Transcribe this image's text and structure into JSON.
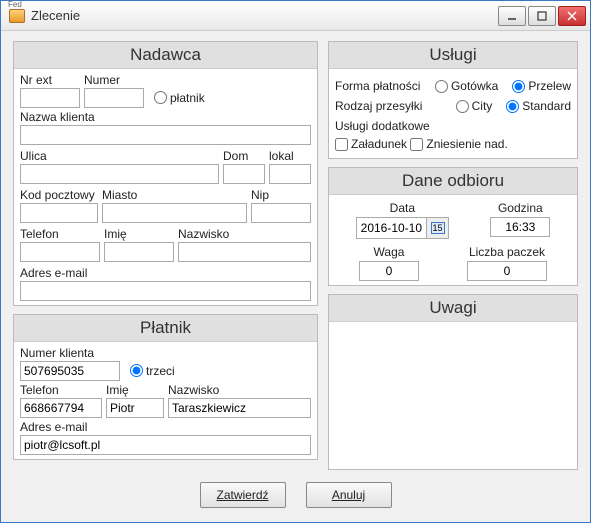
{
  "window": {
    "title": "Zlecenie"
  },
  "nadawca": {
    "heading": "Nadawca",
    "nr_ext_label": "Nr ext",
    "numer_label": "Numer",
    "platnik_radio": "płatnik",
    "nazwa_klienta_label": "Nazwa klienta",
    "ulica_label": "Ulica",
    "dom_label": "Dom",
    "lokal_label": "lokal",
    "kod_label": "Kod pocztowy",
    "miasto_label": "Miasto",
    "nip_label": "Nip",
    "telefon_label": "Telefon",
    "imie_label": "Imię",
    "nazwisko_label": "Nazwisko",
    "email_label": "Adres e-mail",
    "nr_ext": "",
    "numer": "",
    "nazwa_klienta": "",
    "ulica": "",
    "dom": "",
    "lokal": "",
    "kod": "",
    "miasto": "",
    "nip": "",
    "telefon": "",
    "imie": "",
    "nazwisko": "",
    "email": ""
  },
  "platnik": {
    "heading": "Płatnik",
    "numer_klienta_label": "Numer klienta",
    "trzeci_radio": "trzeci",
    "telefon_label": "Telefon",
    "imie_label": "Imię",
    "nazwisko_label": "Nazwisko",
    "email_label": "Adres e-mail",
    "numer_klienta": "507695035",
    "telefon": "668667794",
    "imie": "Piotr",
    "nazwisko": "Taraszkiewicz",
    "email": "piotr@lcsoft.pl"
  },
  "uslugi": {
    "heading": "Usługi",
    "forma_label": "Forma płatności",
    "gotowka": "Gotówka",
    "przelew": "Przelew",
    "rodzaj_label": "Rodzaj przesyłki",
    "city": "City",
    "standard": "Standard",
    "dodatkowe_label": "Usługi dodatkowe",
    "zaladunek": "Załadunek",
    "zniesienie": "Zniesienie nad."
  },
  "odbior": {
    "heading": "Dane odbioru",
    "data_label": "Data",
    "godzina_label": "Godzina",
    "waga_label": "Waga",
    "paczki_label": "Liczba paczek",
    "cal_glyph": "15",
    "data": "2016-10-10",
    "godzina": "16:33",
    "waga": "0",
    "paczki": "0"
  },
  "uwagi": {
    "heading": "Uwagi",
    "text": ""
  },
  "buttons": {
    "zatwierdz": "Zatwierdź",
    "anuluj": "Anuluj"
  }
}
